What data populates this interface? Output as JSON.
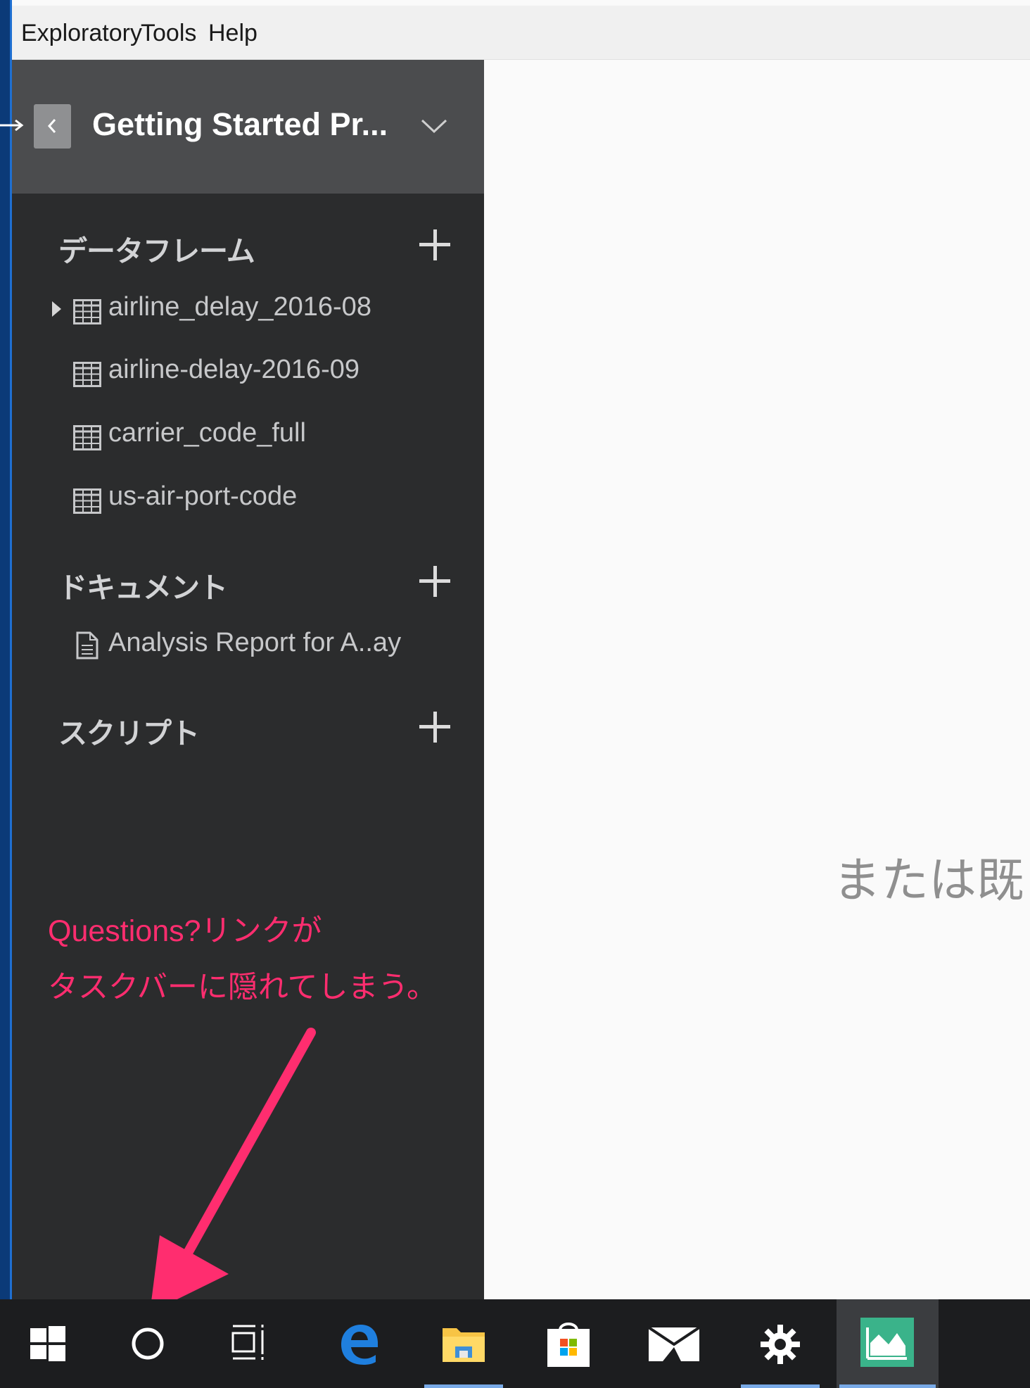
{
  "menubar": {
    "items": [
      "Exploratory",
      "Tools",
      "Help"
    ]
  },
  "project": {
    "title": "Getting Started Pr..."
  },
  "sections": {
    "dataframes": {
      "title": "データフレーム",
      "items": [
        "airline_delay_2016-08",
        "airline-delay-2016-09",
        "carrier_code_full",
        "us-air-port-code"
      ]
    },
    "documents": {
      "title": "ドキュメント",
      "items": [
        "Analysis Report for A..ay"
      ]
    },
    "scripts": {
      "title": "スクリプト",
      "items": []
    }
  },
  "annotation": {
    "lines": [
      "Questions?リンクが",
      "タスクバーに隠れてしまう。"
    ],
    "color": "#ff2d6f"
  },
  "main": {
    "partial_bracket": "「",
    "partial_text": "または既"
  },
  "taskbar": {
    "icons": [
      "windows-start-icon",
      "cortana-icon",
      "task-view-icon",
      "edge-icon",
      "file-explorer-icon",
      "store-icon",
      "mail-icon",
      "settings-icon",
      "exploratory-app-icon"
    ],
    "active": "exploratory-app-icon"
  },
  "colors": {
    "sidebar_bg": "#2b2c2d",
    "header_bg": "#4b4c4e",
    "taskbar_bg": "#1c1d1f",
    "accent": "#78a9e6"
  }
}
